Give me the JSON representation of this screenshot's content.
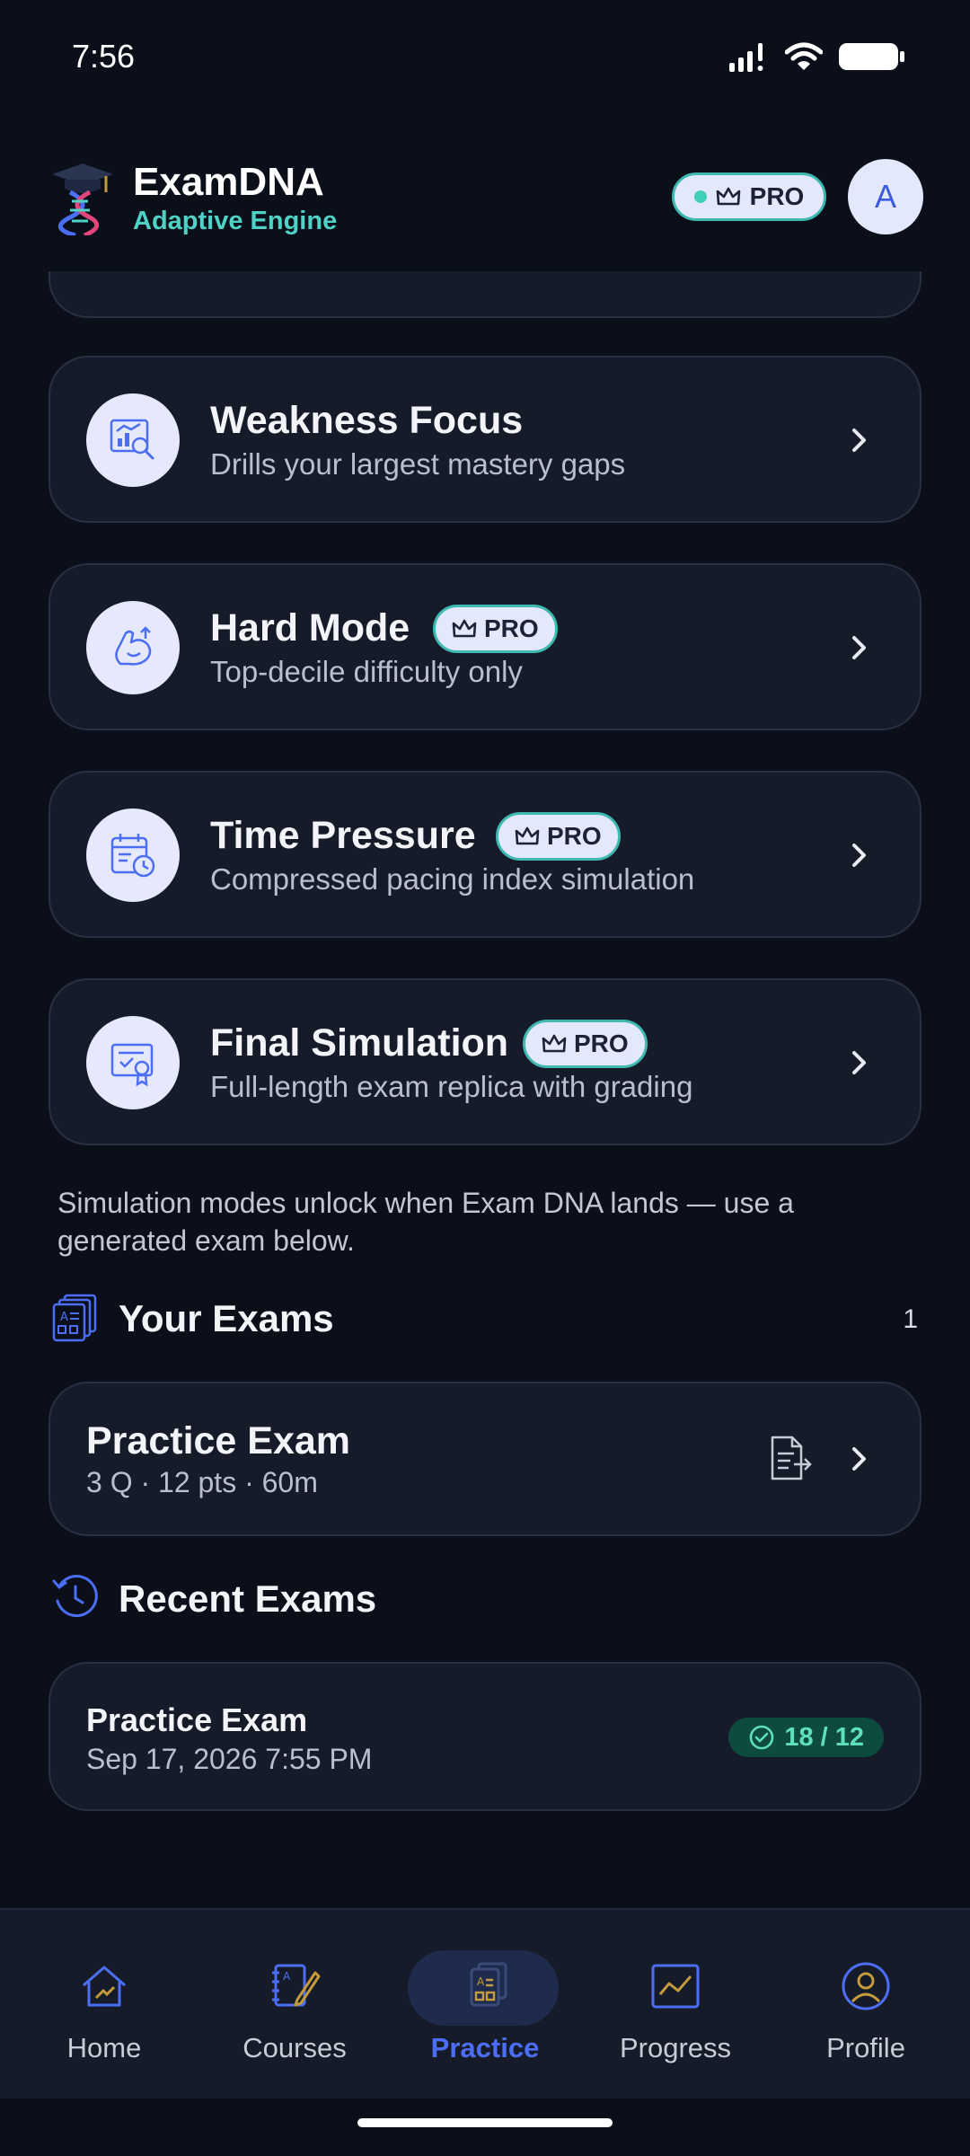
{
  "status": {
    "time": "7:56"
  },
  "header": {
    "title": "ExamDNA",
    "subtitle": "Adaptive Engine",
    "pro_label": "PRO",
    "avatar_initial": "A"
  },
  "modes": [
    {
      "title": "Weakness Focus",
      "desc": "Drills your largest mastery gaps",
      "pro": false,
      "icon": "chart-search-icon"
    },
    {
      "title": "Hard Mode",
      "desc": "Top-decile difficulty only",
      "pro": true,
      "icon": "muscle-icon"
    },
    {
      "title": "Time Pressure",
      "desc": "Compressed pacing index simulation",
      "pro": true,
      "icon": "calendar-clock-icon"
    },
    {
      "title": "Final Simulation",
      "desc": "Full-length exam replica with grading",
      "pro": true,
      "icon": "certificate-icon"
    }
  ],
  "pro_label": "PRO",
  "note": "Simulation modes unlock when Exam DNA lands — use a generated exam below.",
  "your_exams": {
    "title": "Your Exams",
    "count": "1",
    "items": [
      {
        "title": "Practice Exam",
        "meta": "3 Q · 12 pts · 60m"
      }
    ]
  },
  "recent_exams": {
    "title": "Recent Exams",
    "items": [
      {
        "title": "Practice Exam",
        "date": "Sep 17, 2026 7:55 PM",
        "score": "18 / 12"
      }
    ]
  },
  "nav": {
    "items": [
      {
        "label": "Home",
        "icon": "home-icon"
      },
      {
        "label": "Courses",
        "icon": "courses-icon"
      },
      {
        "label": "Practice",
        "icon": "practice-icon",
        "active": true
      },
      {
        "label": "Progress",
        "icon": "progress-chart-icon"
      },
      {
        "label": "Profile",
        "icon": "profile-icon"
      }
    ]
  },
  "colors": {
    "background": "#0b0f1a",
    "card": "#161b29",
    "accent": "#4c6ef5",
    "teal": "#4fd1c5",
    "success": "#5ee0bd"
  }
}
